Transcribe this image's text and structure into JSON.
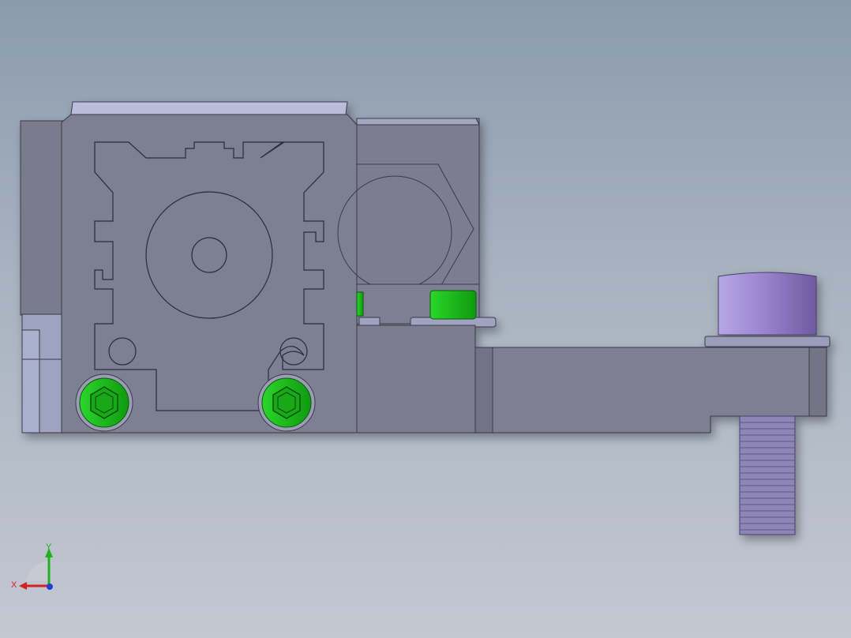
{
  "viewport": {
    "background_top": "#8b9bad",
    "background_bottom": "#c3c8d1",
    "part_color": "#7e7f93",
    "fastener_green": "#1fc21f",
    "knob_violet": "#9b86cf"
  },
  "triad": {
    "x_label": "X",
    "y_label": "Y",
    "x_color": "#d42020",
    "y_color": "#20b020",
    "z_color": "#2040d0"
  }
}
